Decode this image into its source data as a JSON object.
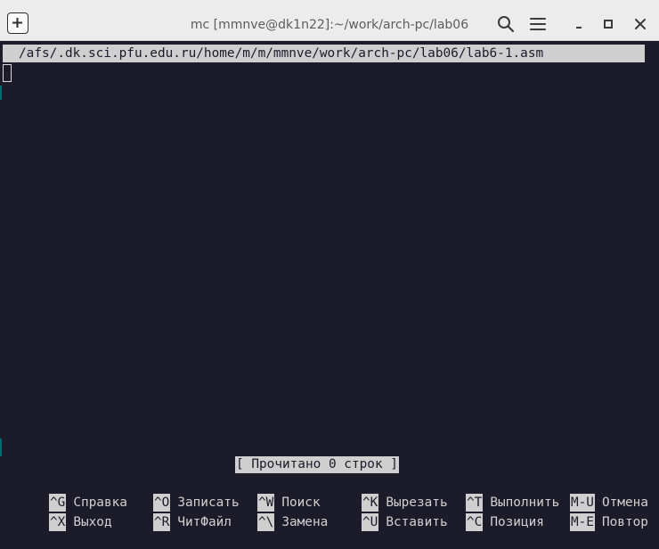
{
  "window": {
    "title": "mc [mmnve@dk1n22]:~/work/arch-pc/lab06"
  },
  "titlebar_icons": {
    "new_tab": "new-tab-icon",
    "search": "search-icon",
    "menu": "hamburger-menu-icon",
    "minimize": "minimize-icon",
    "maximize": "maximize-icon",
    "close": "close-icon"
  },
  "editor": {
    "file_path": "/afs/.dk.sci.pfu.edu.ru/home/m/m/mmnve/work/arch-pc/lab06/lab6-1.asm",
    "status_message": "[ Прочитано 0 строк ]"
  },
  "shortcuts": {
    "row1": [
      {
        "key": "^G",
        "label": "Справка"
      },
      {
        "key": "^O",
        "label": "Записать"
      },
      {
        "key": "^W",
        "label": "Поиск"
      },
      {
        "key": "^K",
        "label": "Вырезать"
      },
      {
        "key": "^T",
        "label": "Выполнить"
      },
      {
        "key": "M-U",
        "label": "Отмена"
      }
    ],
    "row2": [
      {
        "key": "^X",
        "label": "Выход"
      },
      {
        "key": "^R",
        "label": "ЧитФайл"
      },
      {
        "key": "^\\",
        "label": "Замена"
      },
      {
        "key": "^U",
        "label": "Вставить"
      },
      {
        "key": "^C",
        "label": "Позиция"
      },
      {
        "key": "M-E",
        "label": "Повтор"
      }
    ]
  },
  "colors": {
    "terminal_bg": "#1b1b29",
    "terminal_fg": "#d0d0d0",
    "highlight_bg": "#cfcfcf",
    "titlebar_bg": "#ececec"
  }
}
